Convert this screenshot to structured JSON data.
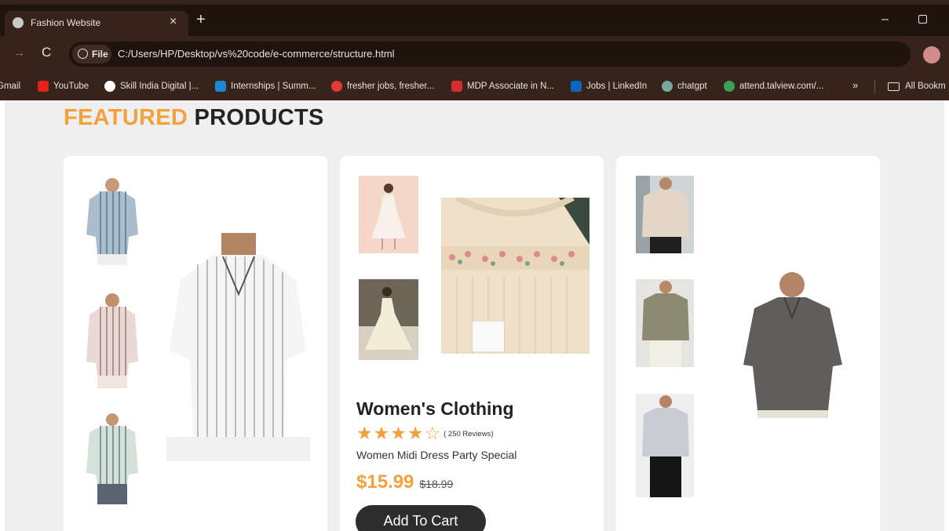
{
  "browser": {
    "tab_title": "Fashion Website",
    "tab_close": "×",
    "new_tab": "+",
    "minimize": "–",
    "security_label": "File",
    "url": "C:/Users/HP/Desktop/vs%20code/e-commerce/structure.html",
    "bookmark_star": "☆",
    "back": "→",
    "reload": "C"
  },
  "bookmarks": {
    "items": [
      {
        "label": "Gmail",
        "color": "#35231c"
      },
      {
        "label": "YouTube",
        "color": "#e62117"
      },
      {
        "label": "Skill India Digital |...",
        "color": "#ffffff"
      },
      {
        "label": "Internships | Summ...",
        "color": "#1e88d6"
      },
      {
        "label": "fresher jobs, fresher...",
        "color": "#e53935"
      },
      {
        "label": "MDP Associate in N...",
        "color": "#d32f2f"
      },
      {
        "label": "Jobs | LinkedIn",
        "color": "#0a66c2"
      },
      {
        "label": "chatgpt",
        "color": "#74aa9c"
      },
      {
        "label": "attend.talview.com/...",
        "color": "#3aa35a"
      }
    ],
    "more": "»",
    "all_bookmarks": "All Bookm"
  },
  "page": {
    "heading_accent": "FEATURED",
    "heading_rest": "PRODUCTS"
  },
  "product": {
    "title": "Women's Clothing",
    "rating": 4,
    "rating_max": 5,
    "reviews": "( 250 Reviews)",
    "description": "Women Midi Dress Party Special",
    "price": "$15.99",
    "old_price": "$18.99",
    "cart_label": "Add To Cart"
  },
  "colors": {
    "accent": "#f2a13d",
    "dark": "#232323",
    "button": "#2d2d2d",
    "page_bg": "#efefef",
    "chrome_bg": "#35231c"
  }
}
